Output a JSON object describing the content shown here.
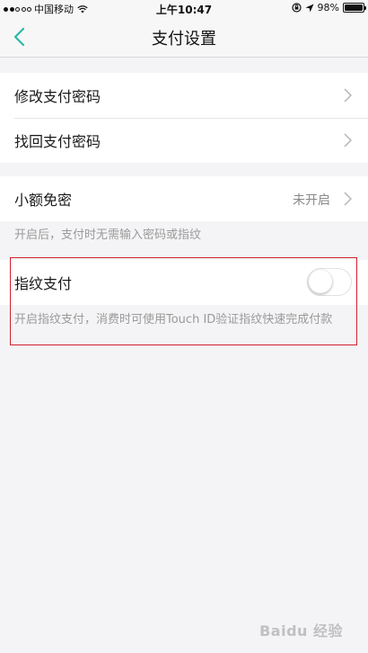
{
  "status_bar": {
    "carrier": "中国移动",
    "time": "上午10:47",
    "battery": "98%",
    "battery_level": 0.98,
    "signal_bars_filled": 2,
    "signal_bars_total": 5
  },
  "nav": {
    "title": "支付设置",
    "back_icon": "chevron-left-icon",
    "accent_color": "#2bb8a6"
  },
  "groups": [
    {
      "rows": [
        {
          "label": "修改支付密码"
        },
        {
          "label": "找回支付密码"
        }
      ]
    }
  ],
  "small_amount": {
    "label": "小额免密",
    "value": "未开启",
    "hint": "开启后，支付时无需输入密码或指纹"
  },
  "fingerprint": {
    "label": "指纹支付",
    "enabled": false,
    "hint": "开启指纹支付，消费时可使用Touch ID验证指纹快速完成付款"
  },
  "highlight_color": "#d0212f",
  "watermark": "Baidu 经验"
}
